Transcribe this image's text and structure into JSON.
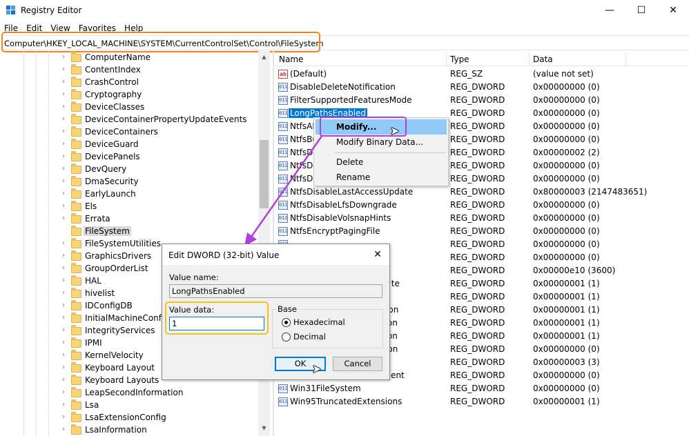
{
  "window": {
    "title": "Registry Editor",
    "minimize": "—",
    "maximize": "☐",
    "close": "✕"
  },
  "menu": [
    "File",
    "Edit",
    "View",
    "Favorites",
    "Help"
  ],
  "address": "Computer\\HKEY_LOCAL_MACHINE\\SYSTEM\\CurrentControlSet\\Control\\FileSystem",
  "tree": {
    "items": [
      "ComputerName",
      "ContentIndex",
      "CrashControl",
      "Cryptography",
      "DeviceClasses",
      "DeviceContainerPropertyUpdateEvents",
      "DeviceContainers",
      "DeviceGuard",
      "DevicePanels",
      "DevQuery",
      "DmaSecurity",
      "EarlyLaunch",
      "Els",
      "Errata",
      "FileSystem",
      "FileSystemUtilities",
      "GraphicsDrivers",
      "GroupOrderList",
      "HAL",
      "hivelist",
      "IDConfigDB",
      "InitialMachineConfig",
      "IntegrityServices",
      "IPMI",
      "KernelVelocity",
      "Keyboard Layout",
      "Keyboard Layouts",
      "LeapSecondInformation",
      "Lsa",
      "LsaExtensionConfig",
      "LsaInformation"
    ],
    "selected": "FileSystem"
  },
  "list": {
    "headers": {
      "name": "Name",
      "type": "Type",
      "data": "Data"
    },
    "rows": [
      {
        "name": "(Default)",
        "type": "REG_SZ",
        "data": "(value not set)",
        "icon": "string-value-icon"
      },
      {
        "name": "DisableDeleteNotification",
        "type": "REG_DWORD",
        "data": "0x00000000 (0)",
        "icon": "dword-value-icon"
      },
      {
        "name": "FilterSupportedFeaturesMode",
        "type": "REG_DWORD",
        "data": "0x00000000 (0)",
        "icon": "dword-value-icon"
      },
      {
        "name": "LongPathsEnabled",
        "type": "REG_DWORD",
        "data": "0x00000000 (0)",
        "icon": "dword-value-icon"
      },
      {
        "name": "NtfsAl",
        "type": "REG_DWORD",
        "data": "0x00000000 (0)",
        "icon": "dword-value-icon"
      },
      {
        "name": "NtfsBu",
        "type": "REG_DWORD",
        "data": "0x00000000 (0)",
        "icon": "dword-value-icon"
      },
      {
        "name": "NtfsDi",
        "type": "REG_DWORD",
        "data": "0x00000002 (2)",
        "icon": "dword-value-icon"
      },
      {
        "name": "NtfsDi",
        "type": "REG_DWORD",
        "data": "0x00000000 (0)",
        "icon": "dword-value-icon"
      },
      {
        "name": "NtfsDi",
        "type": "REG_DWORD",
        "data": "0x00000000 (0)",
        "icon": "dword-value-icon"
      },
      {
        "name": "NtfsDisableLastAccessUpdate",
        "type": "REG_DWORD",
        "data": "0x80000003 (2147483651)",
        "icon": "dword-value-icon"
      },
      {
        "name": "NtfsDisableLfsDowngrade",
        "type": "REG_DWORD",
        "data": "0x00000000 (0)",
        "icon": "dword-value-icon"
      },
      {
        "name": "NtfsDisableVolsnapHints",
        "type": "REG_DWORD",
        "data": "0x00000000 (0)",
        "icon": "dword-value-icon"
      },
      {
        "name": "NtfsEncryptPagingFile",
        "type": "REG_DWORD",
        "data": "0x00000000 (0)",
        "icon": "dword-value-icon"
      },
      {
        "name": "",
        "type": "REG_DWORD",
        "data": "0x00000000 (0)",
        "icon": "dword-value-icon"
      },
      {
        "name": "",
        "type": "REG_DWORD",
        "data": "0x00000000 (0)",
        "icon": "dword-value-icon"
      },
      {
        "name": "",
        "type": "REG_DWORD",
        "data": "0x00000e10 (3600)",
        "icon": "dword-value-icon"
      },
      {
        "name": "te",
        "type": "REG_DWORD",
        "data": "0x00000001 (1)",
        "icon": "dword-value-icon"
      },
      {
        "name": "",
        "type": "REG_DWORD",
        "data": "0x00000001 (1)",
        "icon": "dword-value-icon"
      },
      {
        "name": "ation",
        "type": "REG_DWORD",
        "data": "0x00000001 (1)",
        "icon": "dword-value-icon"
      },
      {
        "name": "aluation",
        "type": "REG_DWORD",
        "data": "0x00000001 (1)",
        "icon": "dword-value-icon"
      },
      {
        "name": "aluation",
        "type": "REG_DWORD",
        "data": "0x00000001 (1)",
        "icon": "dword-value-icon"
      },
      {
        "name": "valuation",
        "type": "REG_DWORD",
        "data": "0x00000000 (0)",
        "icon": "dword-value-icon"
      },
      {
        "name": "",
        "type": "REG_DWORD",
        "data": "0x00000003 (3)",
        "icon": "dword-value-icon"
      },
      {
        "name": "ement",
        "type": "REG_DWORD",
        "data": "0x00000000 (0)",
        "icon": "dword-value-icon"
      },
      {
        "name": "Win31FileSystem",
        "type": "REG_DWORD",
        "data": "0x00000000 (0)",
        "icon": "dword-value-icon"
      },
      {
        "name": "Win95TruncatedExtensions",
        "type": "REG_DWORD",
        "data": "0x00000001 (1)",
        "icon": "dword-value-icon"
      }
    ],
    "selected_index": 3
  },
  "context_menu": {
    "items": [
      "Modify...",
      "Modify Binary Data...",
      "Delete",
      "Rename"
    ]
  },
  "dialog": {
    "title": "Edit DWORD (32-bit) Value",
    "close": "✕",
    "value_name_label": "Value name:",
    "value_name": "LongPathsEnabled",
    "value_data_label": "Value data:",
    "value_data": "1",
    "base_label": "Base",
    "base_options": [
      "Hexadecimal",
      "Decimal"
    ],
    "base_selected": "Hexadecimal",
    "ok": "OK",
    "cancel": "Cancel"
  },
  "colors": {
    "address_highlight": "#f0851f",
    "modify_highlight": "#b23ee0",
    "value_data_highlight": "#f2c419",
    "arrow": "#b23ee0",
    "selection": "#0078d7"
  }
}
